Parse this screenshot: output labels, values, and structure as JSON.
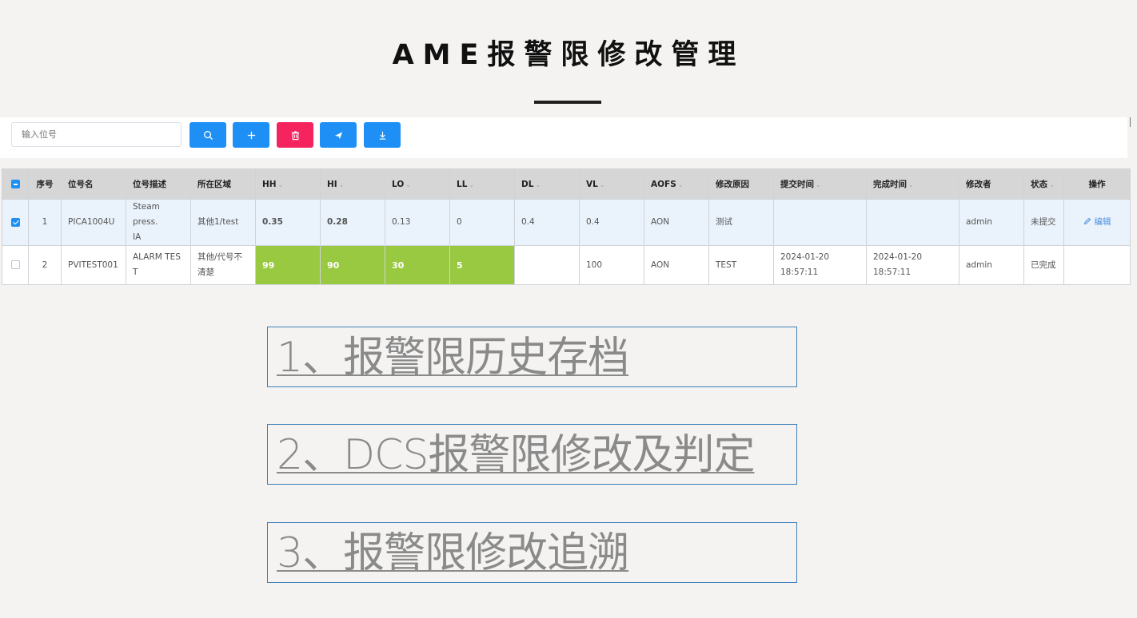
{
  "page": {
    "title": "AME报警限修改管理"
  },
  "toolbar": {
    "search_placeholder": "输入位号",
    "buttons": [
      {
        "icon": "search-icon",
        "color": "#1e90f5"
      },
      {
        "icon": "plus-icon",
        "color": "#1e90f5"
      },
      {
        "icon": "trash-icon",
        "color": "#f5245e"
      },
      {
        "icon": "send-icon",
        "color": "#1e90f5"
      },
      {
        "icon": "download-icon",
        "color": "#1e90f5"
      }
    ]
  },
  "table": {
    "headers": [
      "序号",
      "位号名",
      "位号描述",
      "所在区域",
      "HH",
      "HI",
      "LO",
      "LL",
      "DL",
      "VL",
      "AOFS",
      "修改原因",
      "提交时间",
      "完成时间",
      "修改者",
      "状态",
      "操作"
    ],
    "rows": [
      {
        "checked": true,
        "index": "1",
        "tag": "PICA1004U",
        "desc": "Steam press.\nIA",
        "area": "其他1/test",
        "hh": "0.35",
        "hi": "0.28",
        "lo": "0.13",
        "ll": "0",
        "dl": "0.4",
        "vl": "0.4",
        "aofs": "AON",
        "reason": "测试",
        "submit_time": "",
        "done_time": "",
        "editor": "admin",
        "status": "未提交",
        "action": "编辑"
      },
      {
        "checked": false,
        "index": "2",
        "tag": "PVITEST001",
        "desc": "ALARM TES\nT",
        "area": "其他/代号不\n清楚",
        "hh": "99",
        "hi": "90",
        "lo": "30",
        "ll": "5",
        "dl": "",
        "vl": "100",
        "aofs": "AON",
        "reason": "TEST",
        "submit_time": "2024-01-20 18:57:11",
        "done_time": "2024-01-20 18:57:11",
        "editor": "admin",
        "status": "已完成",
        "action": ""
      }
    ],
    "highlight_color": "#99c940",
    "exceed_color": "#e0284a"
  },
  "menu": {
    "items": [
      "1、报警限历史存档",
      "2、DCS报警限修改及判定",
      "3、报警限修改追溯"
    ]
  }
}
